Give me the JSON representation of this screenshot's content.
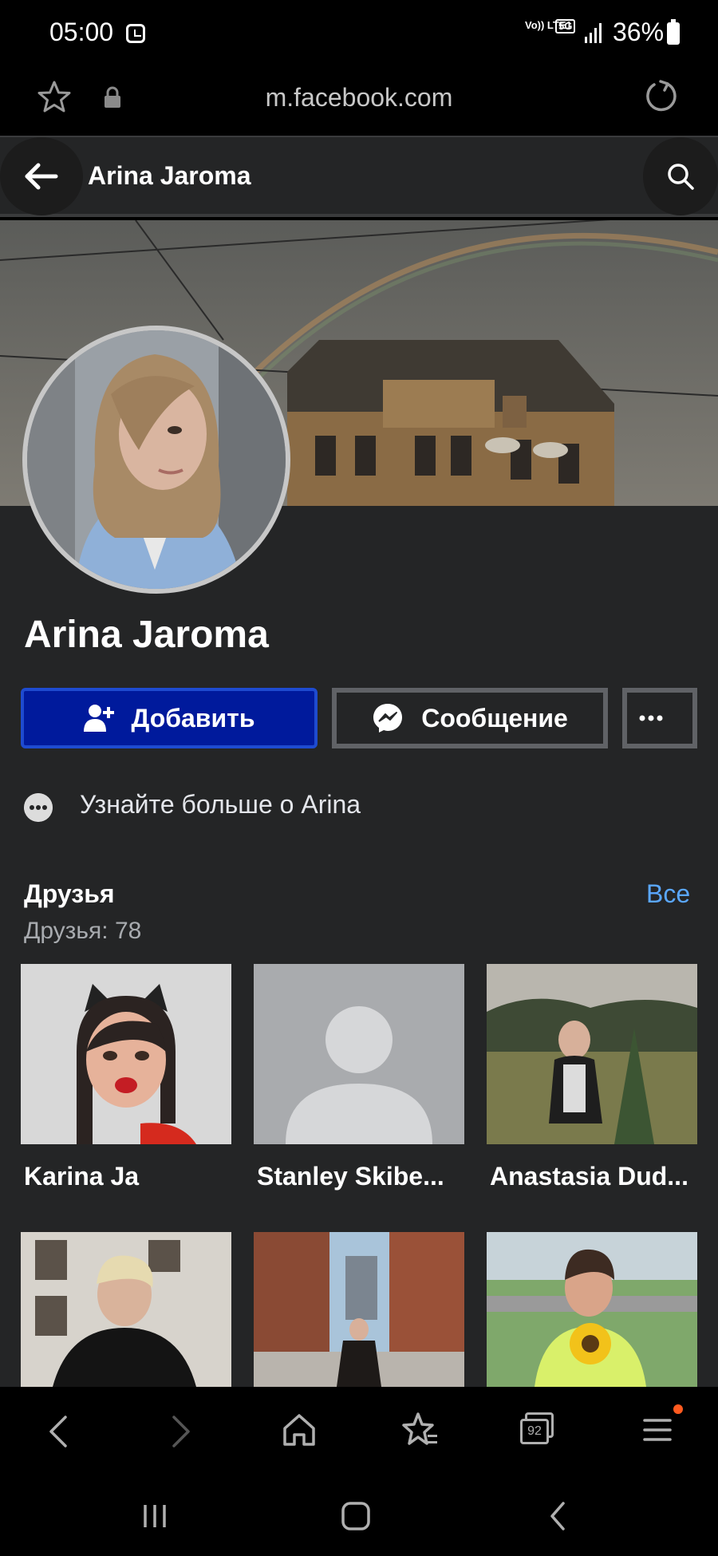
{
  "status_bar": {
    "time": "05:00",
    "volte": "Vo)) LTE1",
    "network": "5G",
    "battery": "36%"
  },
  "browser": {
    "url": "m.facebook.com"
  },
  "header": {
    "title": "Arina Jaroma"
  },
  "profile": {
    "name": "Arina Jaroma",
    "add_friend_label": "Добавить",
    "message_label": "Сообщение",
    "more_label": "•••",
    "about_text": "Узнайте больше о Arina"
  },
  "friends": {
    "title": "Друзья",
    "count_text": "Друзья: 78",
    "see_all": "Все",
    "items": [
      {
        "name": "Karina Ja"
      },
      {
        "name": "Stanley Skibe..."
      },
      {
        "name": "Anastasia Dud..."
      },
      {
        "name": ""
      },
      {
        "name": ""
      },
      {
        "name": ""
      }
    ]
  },
  "browser_nav": {
    "tabs_count": "92"
  },
  "colors": {
    "page_bg": "#242526",
    "primary_button": "#001a9c",
    "link": "#5aa7ff",
    "notification_dot": "#ff5a1f"
  },
  "icons": [
    "alarm-icon",
    "signal-icon",
    "battery-icon",
    "star-icon",
    "lock-icon",
    "reload-icon",
    "back-arrow-icon",
    "search-icon",
    "add-person-icon",
    "messenger-icon",
    "more-dots-icon",
    "about-dots-icon",
    "nav-back-icon",
    "nav-forward-icon",
    "home-icon",
    "bookmarks-icon",
    "tabs-icon",
    "menu-icon",
    "recent-apps-icon",
    "home-button-icon",
    "system-back-icon"
  ]
}
